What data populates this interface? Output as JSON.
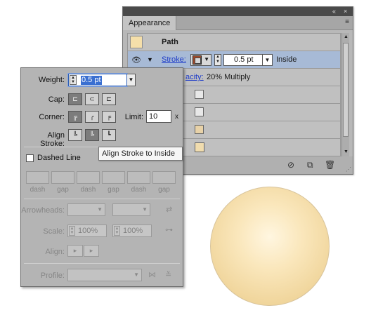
{
  "appearance_panel": {
    "collapse_icon": "«",
    "close_icon": "×",
    "tab": "Appearance",
    "menu_icon": "≡",
    "path_label": "Path",
    "stroke_row": {
      "label": "Stroke:",
      "weight": "0.5 pt",
      "position": "Inside"
    },
    "opacity_row": {
      "label_partial": "acity:",
      "value": "20% Multiply"
    },
    "fill_color": "#f0dcae",
    "swatch_color": "#a04a2a",
    "selection_color": "#a7bad6",
    "footer_icons": [
      "no-symbol-icon",
      "duplicate-icon",
      "trash-icon"
    ]
  },
  "stroke_panel": {
    "weight_label": "Weight:",
    "weight_value": "0.5 pt",
    "cap_label": "Cap:",
    "corner_label": "Corner:",
    "limit_label": "Limit:",
    "limit_value": "10",
    "limit_unit": "x",
    "align_label": "Align Stroke:",
    "dashed_label": "Dashed Line",
    "dash_labels": [
      "dash",
      "gap",
      "dash",
      "gap",
      "dash",
      "gap"
    ],
    "arrowheads_label": "Arrowheads:",
    "scale_label": "Scale:",
    "scale_value_1": "100%",
    "scale_value_2": "100%",
    "align_arrow_label": "Align:",
    "profile_label": "Profile:"
  },
  "tooltip": {
    "text": "Align Stroke to Inside"
  },
  "accent_color": "#3a6fd1"
}
